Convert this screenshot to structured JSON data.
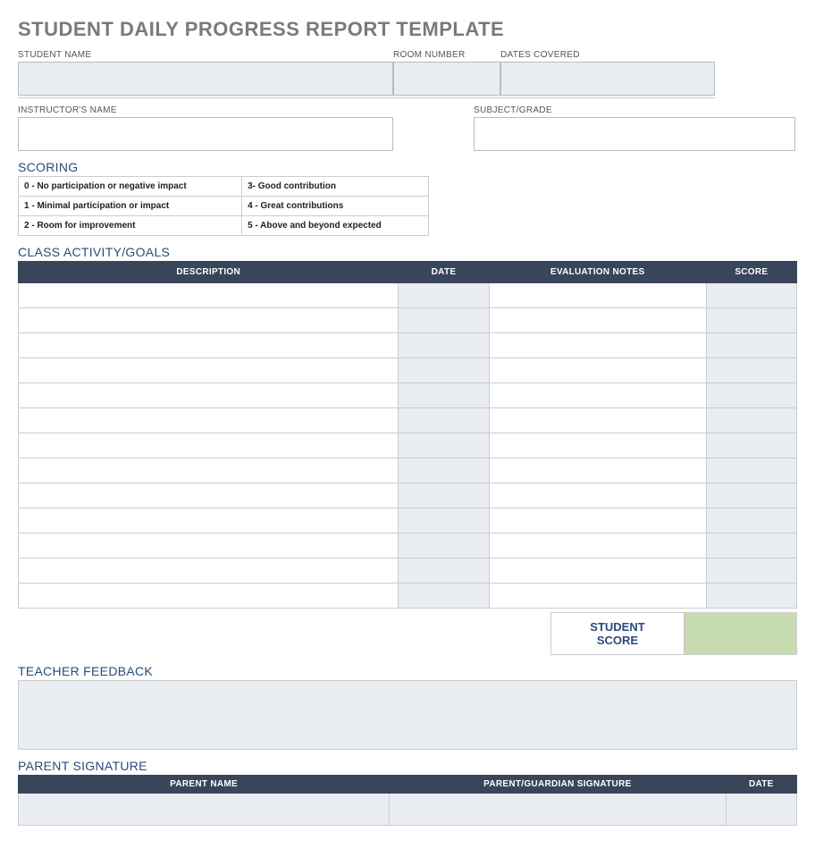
{
  "title": "STUDENT DAILY PROGRESS REPORT TEMPLATE",
  "fields": {
    "student_name_label": "STUDENT NAME",
    "room_number_label": "ROOM NUMBER",
    "dates_covered_label": "DATES COVERED",
    "instructor_name_label": "INSTRUCTOR'S NAME",
    "subject_grade_label": "SUBJECT/GRADE"
  },
  "scoring": {
    "heading": "SCORING",
    "rows": [
      {
        "left": "0 - No participation or negative impact",
        "right": "3- Good contribution"
      },
      {
        "left": "1 - Minimal participation or impact",
        "right": "4 - Great contributions"
      },
      {
        "left": "2 - Room for improvement",
        "right": "5 - Above and beyond expected"
      }
    ]
  },
  "activity": {
    "heading": "CLASS ACTIVITY/GOALS",
    "headers": {
      "description": "DESCRIPTION",
      "date": "DATE",
      "evaluation_notes": "EVALUATION NOTES",
      "score": "SCORE"
    },
    "row_count": 13,
    "student_score_label": "STUDENT SCORE"
  },
  "feedback": {
    "heading": "TEACHER FEEDBACK"
  },
  "parent": {
    "heading": "PARENT SIGNATURE",
    "headers": {
      "parent_name": "PARENT NAME",
      "signature": "PARENT/GUARDIAN SIGNATURE",
      "date": "DATE"
    }
  }
}
